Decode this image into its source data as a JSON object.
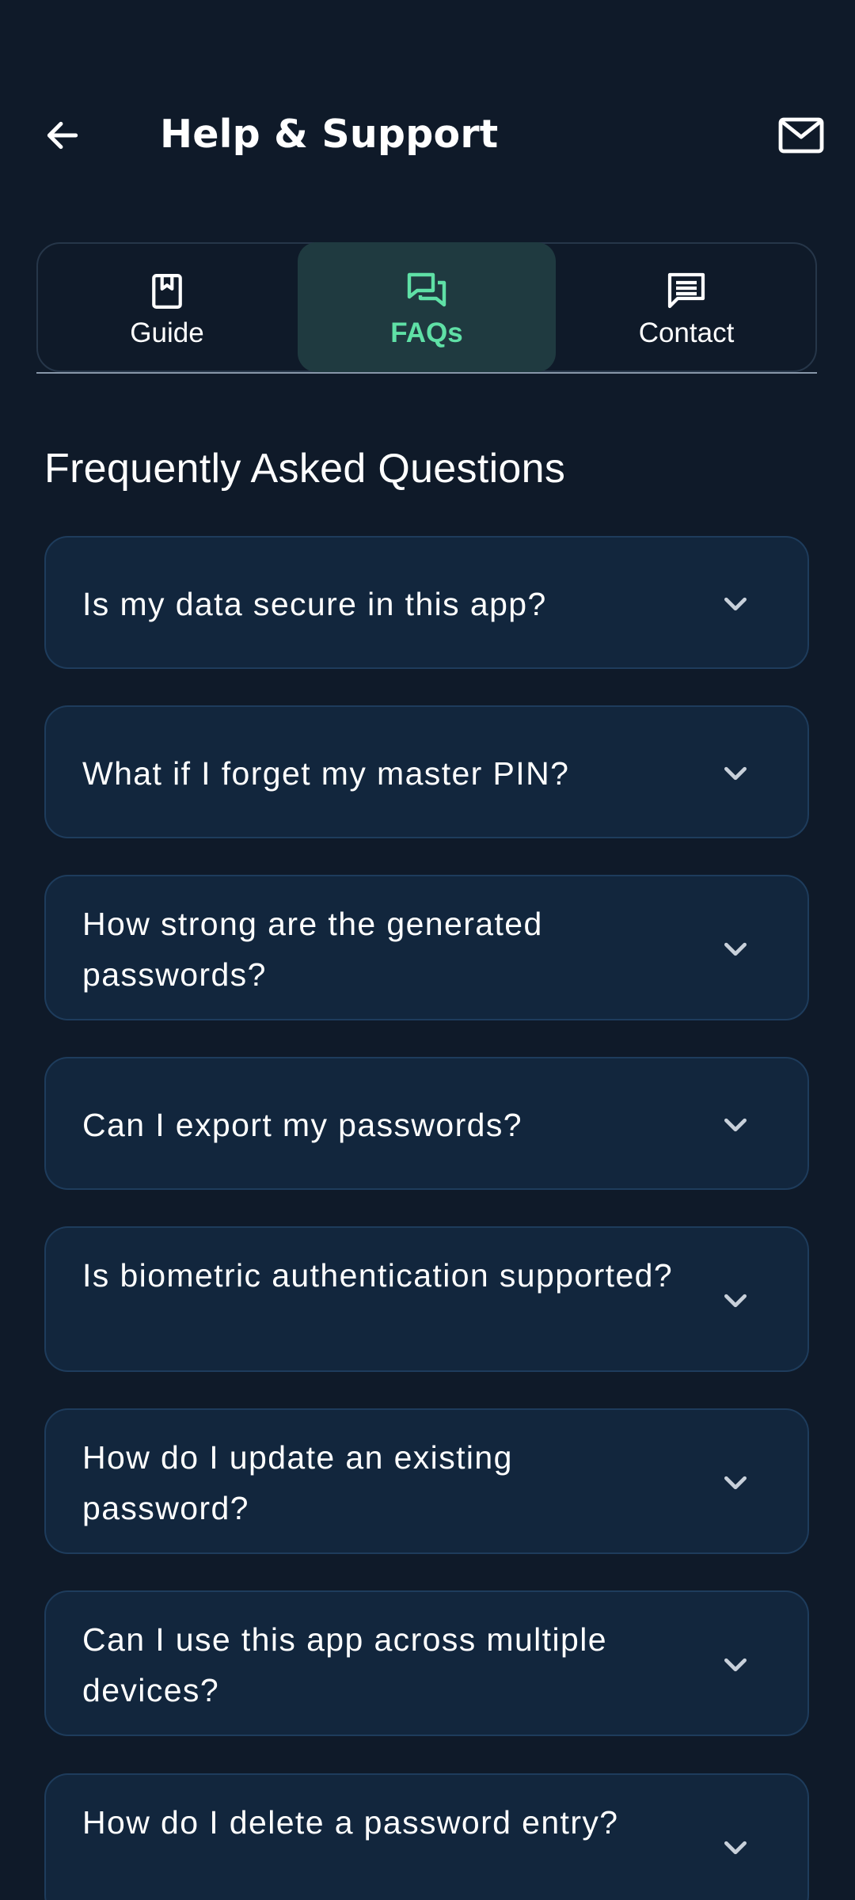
{
  "header": {
    "title": "Help & Support",
    "back_icon": "arrow-left-icon",
    "mail_icon": "mail-icon"
  },
  "tabs": [
    {
      "label": "Guide",
      "icon": "book-icon",
      "active": false
    },
    {
      "label": "FAQs",
      "icon": "chat-bubbles-icon",
      "active": true
    },
    {
      "label": "Contact",
      "icon": "message-icon",
      "active": false
    }
  ],
  "section": {
    "title": "Frequently Asked Questions"
  },
  "faqs": [
    {
      "question": "Is my data secure in this app?"
    },
    {
      "question": "What if I forget my master PIN?"
    },
    {
      "question": "How strong are the generated passwords?"
    },
    {
      "question": "Can I export my passwords?"
    },
    {
      "question": "Is biometric authentication supported?"
    },
    {
      "question": "How do I update an existing password?"
    },
    {
      "question": "Can I use this app across multiple devices?"
    },
    {
      "question": "How do I delete a password entry?"
    }
  ],
  "colors": {
    "background": "#0f1a29",
    "card": "#12263d",
    "card_border": "#1e3c5c",
    "accent": "#5fe0a6",
    "active_tab_bg": "#1f3a40"
  }
}
